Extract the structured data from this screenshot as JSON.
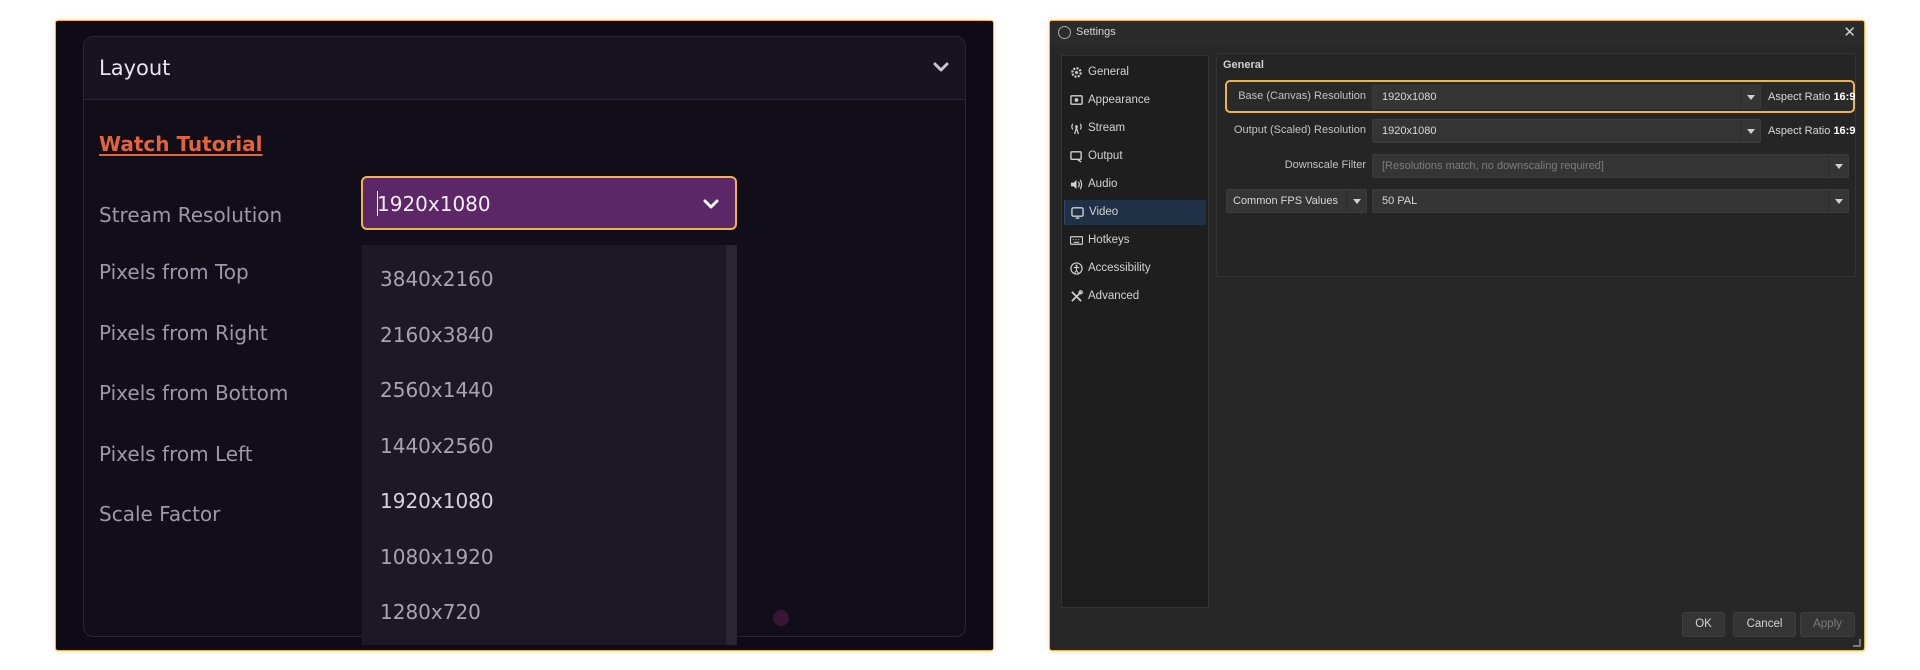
{
  "left": {
    "layout_title": "Layout",
    "watch_tutorial": "Watch Tutorial",
    "labels": {
      "stream_resolution": "Stream Resolution",
      "pixels_top": "Pixels from Top",
      "pixels_right": "Pixels from Right",
      "pixels_bottom": "Pixels from Bottom",
      "pixels_left": "Pixels from Left",
      "scale_factor": "Scale Factor"
    },
    "stream_resolution_value": "1920x1080",
    "resolution_options": [
      "3840x2160",
      "2160x3840",
      "2560x1440",
      "1440x2560",
      "1920x1080",
      "1080x1920",
      "1280x720"
    ],
    "selected_option": "1920x1080",
    "accent_color": "#f0b34a",
    "select_color": "#5b2766",
    "link_color": "#e0643c"
  },
  "settings": {
    "window_title": "Settings",
    "close_glyph": "✕",
    "nav": [
      {
        "label": "General",
        "icon": "gear-icon"
      },
      {
        "label": "Appearance",
        "icon": "appearance-icon"
      },
      {
        "label": "Stream",
        "icon": "stream-icon"
      },
      {
        "label": "Output",
        "icon": "output-icon"
      },
      {
        "label": "Audio",
        "icon": "audio-icon"
      },
      {
        "label": "Video",
        "icon": "video-icon"
      },
      {
        "label": "Hotkeys",
        "icon": "keyboard-icon"
      },
      {
        "label": "Accessibility",
        "icon": "accessibility-icon"
      },
      {
        "label": "Advanced",
        "icon": "tools-icon"
      }
    ],
    "active_nav": "Video",
    "group_title": "General",
    "base_label": "Base (Canvas) Resolution",
    "base_value": "1920x1080",
    "base_aspect_prefix": "Aspect Ratio",
    "base_aspect_value": "16:9",
    "output_label": "Output (Scaled) Resolution",
    "output_value": "1920x1080",
    "output_aspect_prefix": "Aspect Ratio",
    "output_aspect_value": "16:9",
    "downscale_label": "Downscale Filter",
    "downscale_value": "[Resolutions match, no downscaling required]",
    "fps_type": "Common FPS Values",
    "fps_value": "50 PAL",
    "buttons": {
      "ok": "OK",
      "cancel": "Cancel",
      "apply": "Apply"
    }
  }
}
